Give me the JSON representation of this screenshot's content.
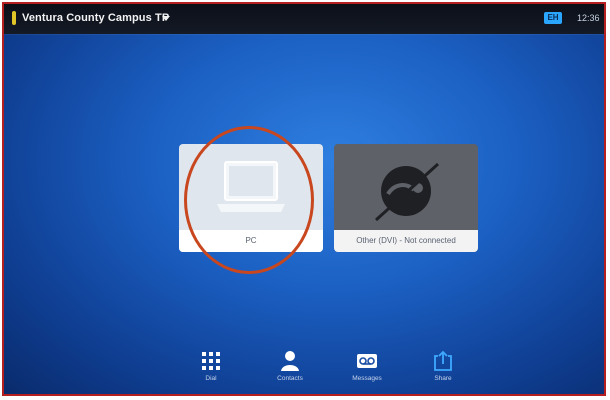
{
  "topbar": {
    "system_name": "Ventura County Campus TP",
    "selfview_badge": "EH",
    "clock": "12:36"
  },
  "sources": [
    {
      "label": "PC",
      "icon": "laptop-icon",
      "status": "available"
    },
    {
      "label": "Other (DVI) - Not connected",
      "icon": "no-signal-icon",
      "status": "not-connected"
    }
  ],
  "nav": {
    "dial": "Dial",
    "contacts": "Contacts",
    "messages": "Messages",
    "share": "Share"
  },
  "colors": {
    "highlight": "#c8471e",
    "frame": "#b41f1f",
    "status_dot": "#e2c627",
    "accent": "#2aa6ff"
  }
}
